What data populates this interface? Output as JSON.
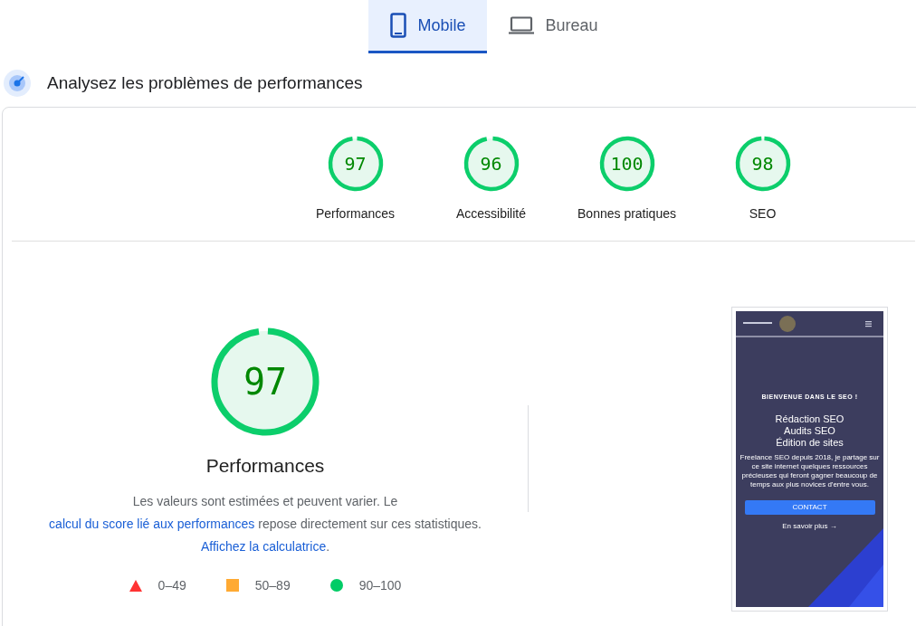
{
  "tabs": [
    {
      "label": "Mobile",
      "kind": "phone",
      "selected": true
    },
    {
      "label": "Bureau",
      "kind": "laptop",
      "selected": false
    }
  ],
  "heading": "Analysez les problèmes de performances",
  "categories": [
    {
      "score": "97",
      "label": "Performances",
      "level": 0.97
    },
    {
      "score": "96",
      "label": "Accessibilité",
      "level": 0.96
    },
    {
      "score": "100",
      "label": "Bonnes pratiques",
      "level": 1
    },
    {
      "score": "98",
      "label": "SEO",
      "level": 0.98
    }
  ],
  "main_gauge": {
    "score": "97",
    "label": "Performances",
    "level": 0.97
  },
  "description": [
    {
      "kind": "text",
      "text": "Les valeurs sont estimées et peuvent varier. Le "
    },
    {
      "kind": "link",
      "text": "calcul du score lié aux performances"
    },
    {
      "kind": "text",
      "text": " repose directement sur ces statistiques. "
    },
    {
      "kind": "link",
      "text": "Affichez la calculatrice"
    },
    {
      "kind": "text",
      "text": "."
    }
  ],
  "legend": [
    {
      "kind": "triangle",
      "range": "0–49",
      "color": "#ff3333"
    },
    {
      "kind": "square",
      "range": "50–89",
      "color": "#ffaa33"
    },
    {
      "kind": "circle",
      "range": "90–100",
      "color": "#00cc66"
    }
  ],
  "screenshot": {
    "eyebrow": "BIENVENUE DANS LE SEO !",
    "title_lines": [
      "Rédaction SEO",
      "Audits SEO",
      "Édition de sites"
    ],
    "text": "Freelance SEO depuis 2018, je partage sur ce site internet quelques ressources précieuses qui feront gagner beaucoup de temps aux plus novices d'entre vous.",
    "button": "CONTACT",
    "link": "En savoir plus →"
  }
}
